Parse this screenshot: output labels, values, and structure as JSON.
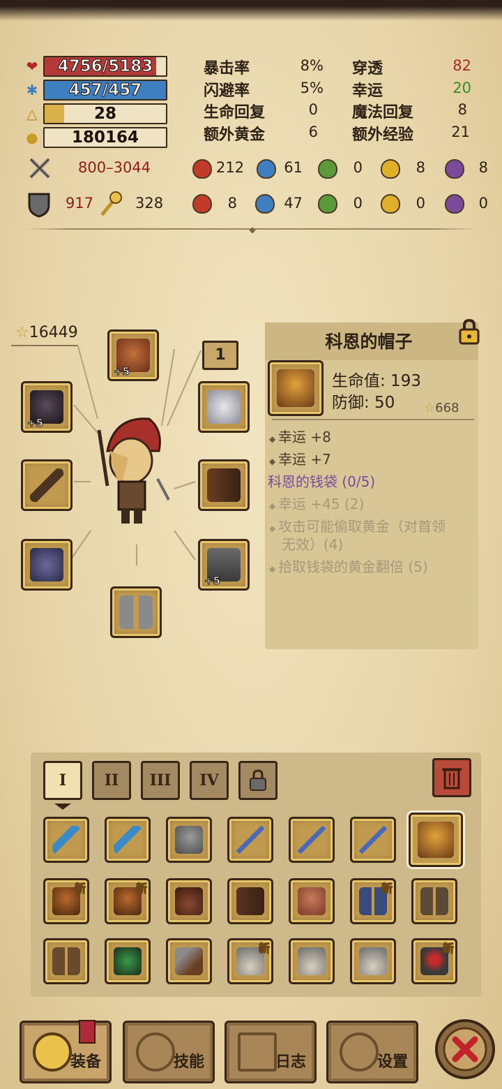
{
  "colors": {
    "hp": "#a52a2a",
    "mp": "#3f7ebf",
    "xp": "#d9b04a",
    "accent_purple": "#7b4a9b",
    "value_red": "#a52a2a",
    "value_green": "#3a8a2a"
  },
  "bars": {
    "hp": {
      "text": "4756/5183",
      "fill_fraction": 0.918
    },
    "mp": {
      "text": "457/457",
      "fill_fraction": 1.0
    },
    "level": {
      "text": "28",
      "fill_fraction": 0.16
    },
    "gold": {
      "text": "180164"
    }
  },
  "stats": [
    {
      "label": "暴击率",
      "value": "8%"
    },
    {
      "label": "穿透",
      "value": "82"
    },
    {
      "label": "闪避率",
      "value": "5%"
    },
    {
      "label": "幸运",
      "value": "20"
    },
    {
      "label": "生命回复",
      "value": "0"
    },
    {
      "label": "魔法回复",
      "value": "8"
    },
    {
      "label": "额外黄金",
      "value": "6"
    },
    {
      "label": "额外经验",
      "value": "21"
    }
  ],
  "attack": {
    "damage": "800–3044"
  },
  "elem_attack": [
    "212",
    "61",
    "0",
    "8",
    "8"
  ],
  "defense": {
    "armor": "917",
    "magic": "328"
  },
  "elem_defense": [
    "8",
    "47",
    "0",
    "0",
    "0"
  ],
  "equipment": {
    "score": "16449",
    "slot_badge": "1",
    "helmet_plus": "+5",
    "head_plus": "+5",
    "legs_plus": "+5"
  },
  "item_panel": {
    "title": "科恩的帽子",
    "hp_label": "生命值: 193",
    "def_label": "防御: 50",
    "score": "668",
    "bonuses": [
      "幸运 +8",
      "幸运 +7"
    ],
    "set_name": "科恩的钱袋 (0/5)",
    "set_bonuses": [
      "幸运 +45 (2)",
      "攻击可能偷取黄金（对首领",
      "无效）(4)",
      "拾取钱袋的黄金翻倍 (5)"
    ]
  },
  "tabs": [
    "I",
    "II",
    "III",
    "IV"
  ],
  "new_tag": "新",
  "nav": {
    "equip": "装备",
    "skills": "技能",
    "log": "日志",
    "settings": "设置"
  }
}
